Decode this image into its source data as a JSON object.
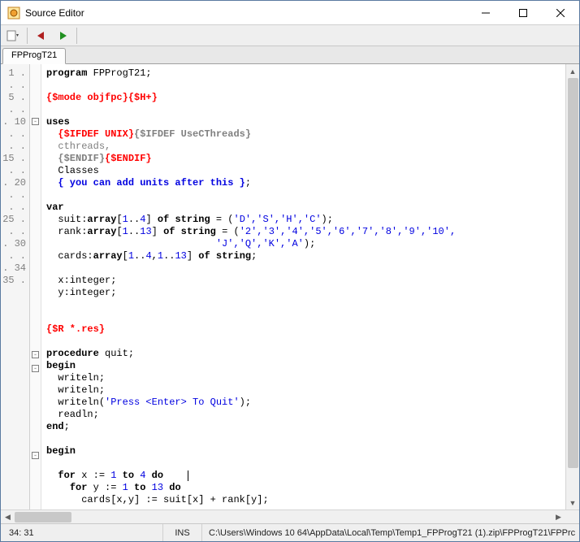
{
  "window": {
    "title": "Source Editor"
  },
  "tabs": {
    "active": "FPProgT21"
  },
  "status": {
    "cursor": "34: 31",
    "mode": "INS",
    "path": "C:\\Users\\Windows 10 64\\AppData\\Local\\Temp\\Temp1_FPProgT21 (1).zip\\FPProgT21\\FPPrc"
  },
  "gutter": {
    "labels": [
      "1",
      ".",
      ".",
      ".",
      "5",
      ".",
      ".",
      ".",
      ".",
      "10",
      ".",
      ".",
      ".",
      ".",
      "15",
      ".",
      ".",
      ".",
      ".",
      "20",
      ".",
      ".",
      ".",
      ".",
      "25",
      ".",
      ".",
      ".",
      ".",
      "30",
      ".",
      ".",
      ".",
      "34",
      "35",
      ".",
      ""
    ]
  },
  "code": {
    "l1_kw": "program",
    "l1_id": " FPProgT21;",
    "l3_dir": "{$mode objfpc}{$H+}",
    "l5_kw": "uses",
    "l6_dir1": "{$IFDEF UNIX}",
    "l6_dir2": "{$IFDEF UseCThreads}",
    "l7_txt": "cthreads,",
    "l8_dir1": "{$ENDIF}",
    "l8_dir2": "{$ENDIF}",
    "l9_txt": "Classes",
    "l10_cmt": "{ you can add units after this }",
    "l10_end": ";",
    "l12_kw": "var",
    "l13_a": "suit:",
    "l13_kw1": "array",
    "l13_b": "[",
    "l13_n1": "1",
    "l13_c": "..",
    "l13_n2": "4",
    "l13_d": "] ",
    "l13_kw2": "of",
    "l13_e": " ",
    "l13_kw3": "string",
    "l13_f": " = (",
    "l13_s": "'D','S','H','C'",
    "l13_g": ");",
    "l14_a": "rank:",
    "l14_kw1": "array",
    "l14_b": "[",
    "l14_n1": "1",
    "l14_c": "..",
    "l14_n2": "13",
    "l14_d": "] ",
    "l14_kw2": "of",
    "l14_e": " ",
    "l14_kw3": "string",
    "l14_f": " = (",
    "l14_s": "'2','3','4','5','6','7','8','9','10',",
    "l15_s": "'J','Q','K','A'",
    "l15_g": ");",
    "l16_a": "cards:",
    "l16_kw1": "array",
    "l16_b": "[",
    "l16_n1": "1",
    "l16_c": "..",
    "l16_n2": "4",
    "l16_c2": ",",
    "l16_n3": "1",
    "l16_c3": "..",
    "l16_n4": "13",
    "l16_d": "] ",
    "l16_kw2": "of",
    "l16_e": " ",
    "l16_kw3": "string",
    "l16_f": ";",
    "l18_a": "x:integer;",
    "l19_a": "y:integer;",
    "l22_dir": "{$R *.res}",
    "l24_kw": "procedure",
    "l24_id": " quit;",
    "l25_kw": "begin",
    "l26_a": "writeln;",
    "l27_a": "writeln;",
    "l28_a": "writeln(",
    "l28_s": "'Press <Enter> To Quit'",
    "l28_b": ");",
    "l29_a": "readln;",
    "l30_kw": "end",
    "l30_b": ";",
    "l32_kw": "begin",
    "l34_a": "for",
    "l34_b": " x := ",
    "l34_n1": "1",
    "l34_c": " ",
    "l34_kw2": "to",
    "l34_d": " ",
    "l34_n2": "4",
    "l34_e": " ",
    "l34_kw3": "do",
    "l35_a": "for",
    "l35_b": " y := ",
    "l35_n1": "1",
    "l35_c": " ",
    "l35_kw2": "to",
    "l35_d": " ",
    "l35_n2": "13",
    "l35_e": " ",
    "l35_kw3": "do",
    "l36_a": "cards[x,y] := suit[x] + rank[y];"
  }
}
